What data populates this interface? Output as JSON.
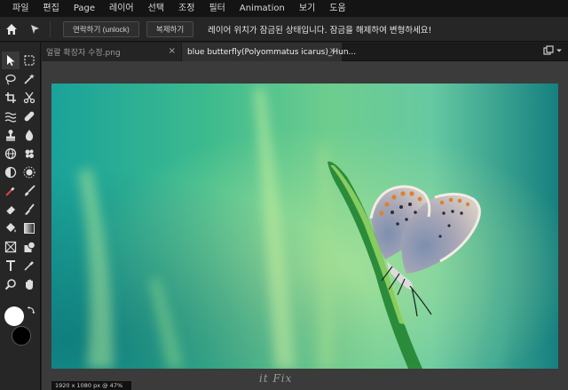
{
  "menu": [
    "파일",
    "편집",
    "Page",
    "레이어",
    "선택",
    "조정",
    "필터",
    "Animation",
    "보기",
    "도움"
  ],
  "options": {
    "unlock_label": "연락하기 (unlock)",
    "duplicate_label": "복제하기",
    "message": "레이어 위치가 잠금된 상태입니다. 잠금을 해제하여 변형하세요!"
  },
  "tabs": [
    {
      "label": "얼랄 확장자 수정.png",
      "active": false
    },
    {
      "label": "blue butterfly(Polyommatus icarus)_Hun...",
      "active": true
    }
  ],
  "status": {
    "zoom_info": "1920 x 1080 px @ 47%"
  },
  "watermark": "it Fix",
  "colors": {
    "foreground": "#ffffff",
    "background": "#000000"
  },
  "tools": [
    "select-arrow",
    "marquee",
    "lasso",
    "magic-wand",
    "crop",
    "cut",
    "liquify",
    "heal",
    "clone-stamp",
    "blur",
    "sphere",
    "sponge",
    "dodge-burn",
    "spot",
    "eyedropper-red",
    "brush",
    "eraser",
    "smudge",
    "fill",
    "gradient",
    "frame",
    "shape",
    "text",
    "picker",
    "zoom",
    "hand"
  ]
}
